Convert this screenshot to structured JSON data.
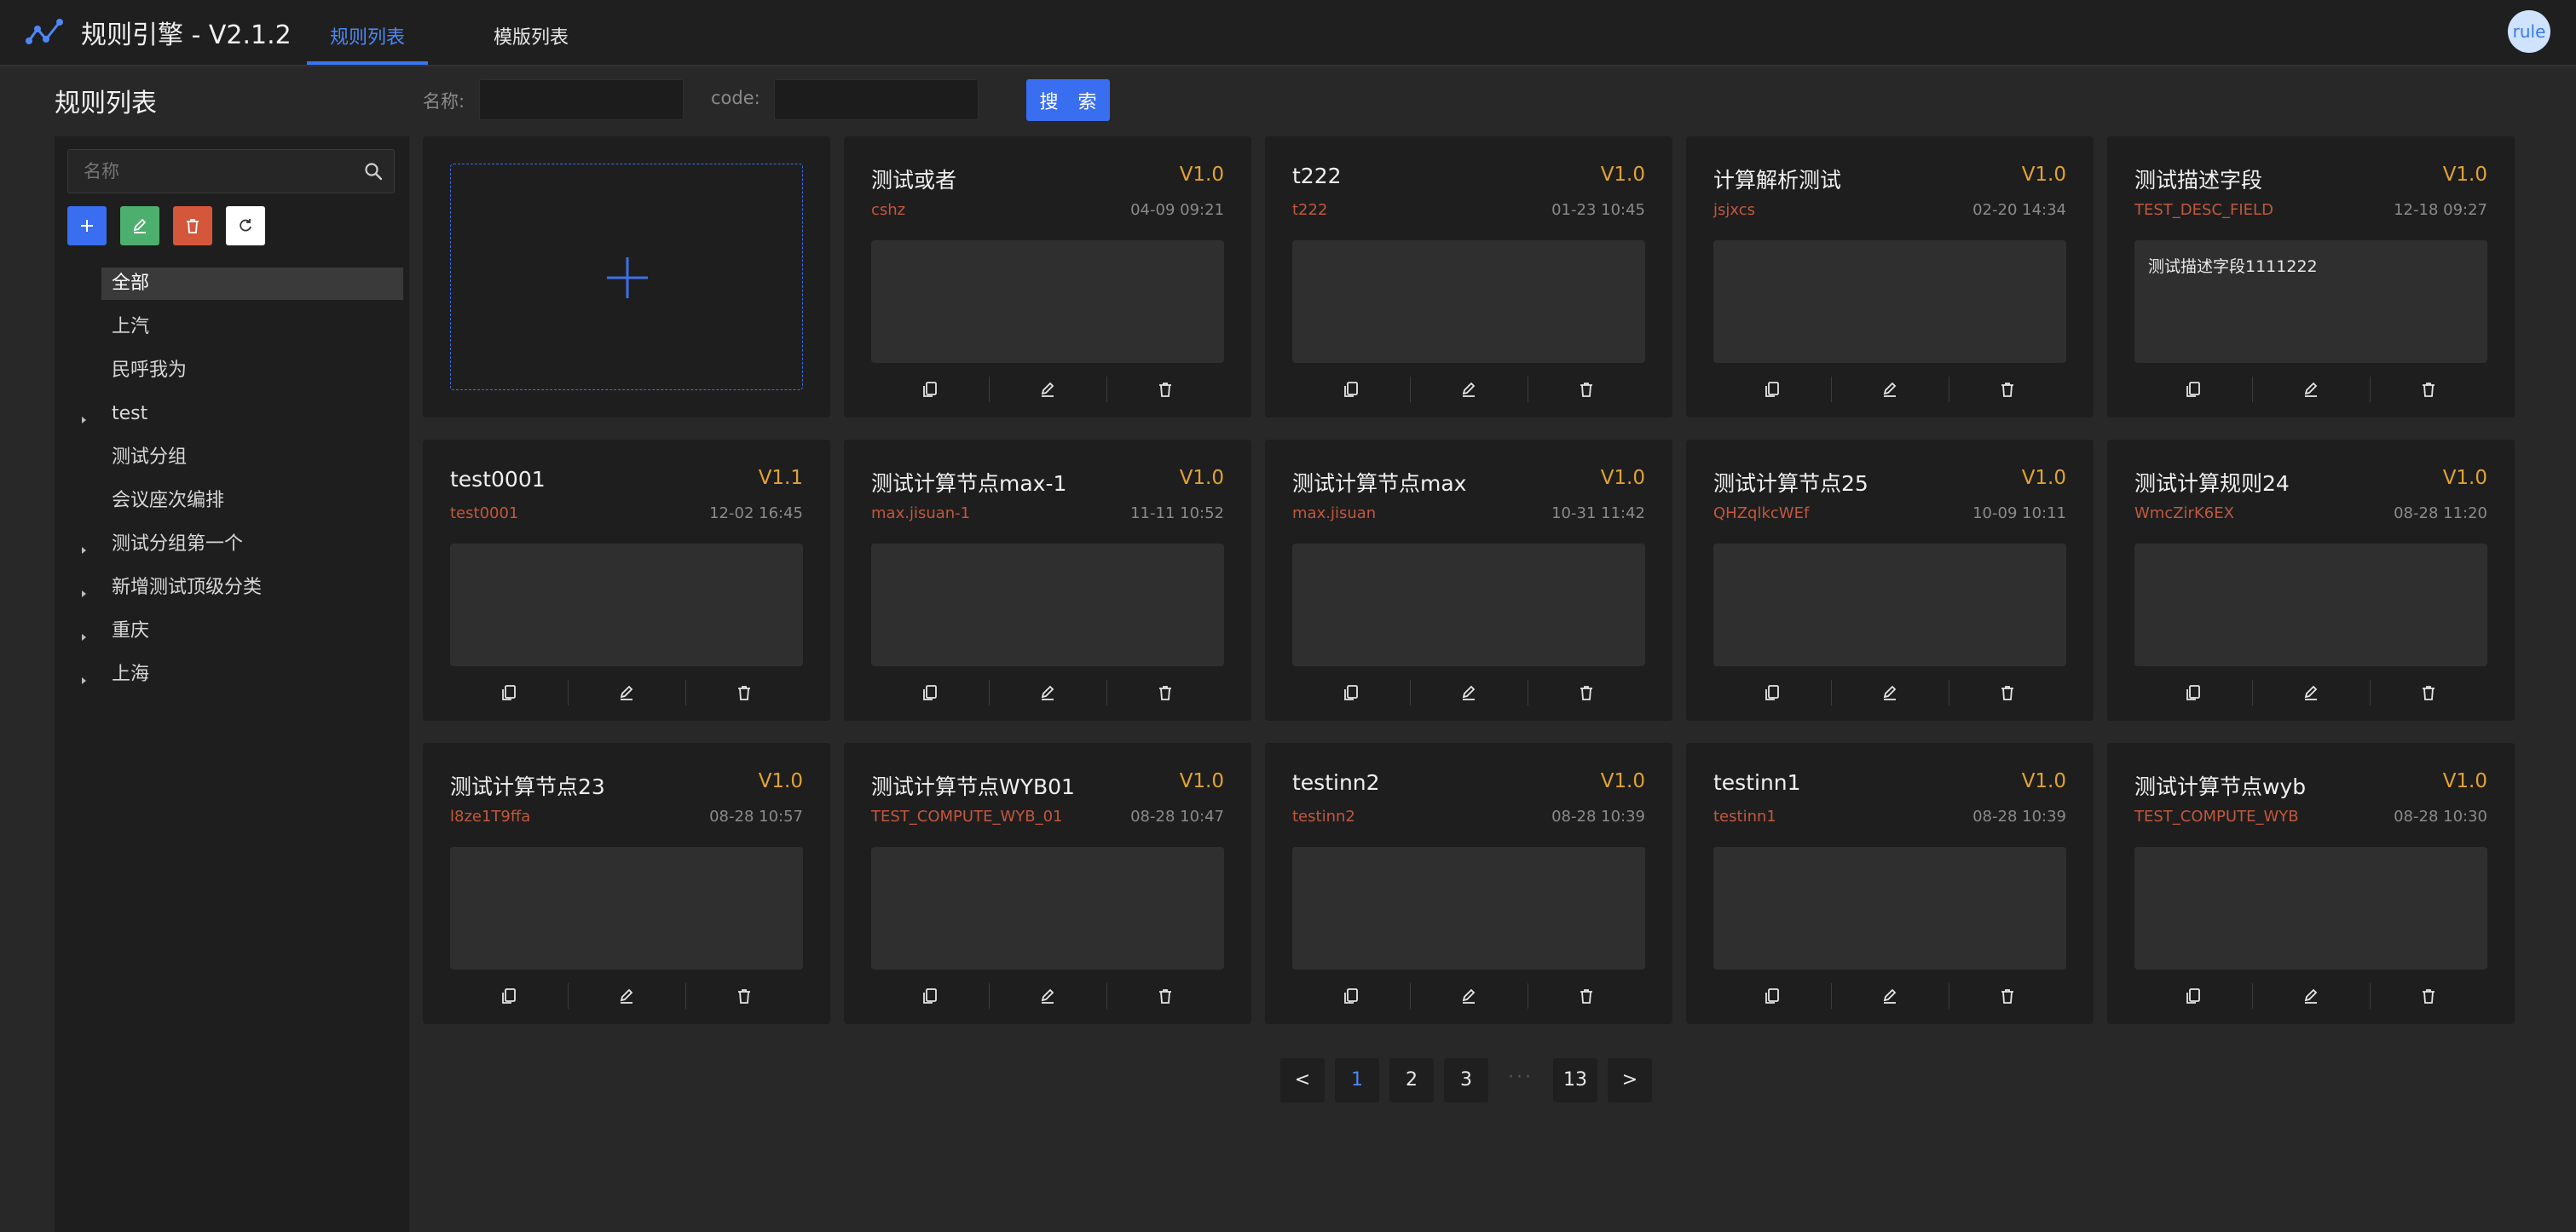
{
  "header": {
    "app_title": "规则引擎 - V2.1.2",
    "tabs": [
      {
        "label": "规则列表",
        "active": true
      },
      {
        "label": "模版列表",
        "active": false
      }
    ],
    "avatar_text": "rule",
    "accent_color": "#3a6ef0"
  },
  "page_title": "规则列表",
  "search": {
    "name_label": "名称:",
    "name_value": "",
    "code_label": "code:",
    "code_value": "",
    "button_label": "搜 索"
  },
  "sidebar": {
    "search_placeholder": "名称",
    "tools": [
      {
        "name": "add",
        "color": "#3a6ef0"
      },
      {
        "name": "edit",
        "color": "#4caf6e"
      },
      {
        "name": "delete",
        "color": "#d4573c"
      },
      {
        "name": "refresh",
        "color": "#ffffff"
      }
    ],
    "tree": [
      {
        "label": "全部",
        "selected": true,
        "has_children": false
      },
      {
        "label": "上汽",
        "selected": false,
        "has_children": false
      },
      {
        "label": "民呼我为",
        "selected": false,
        "has_children": false
      },
      {
        "label": "test",
        "selected": false,
        "has_children": true
      },
      {
        "label": "测试分组",
        "selected": false,
        "has_children": false
      },
      {
        "label": "会议座次编排",
        "selected": false,
        "has_children": false
      },
      {
        "label": "测试分组第一个",
        "selected": false,
        "has_children": true
      },
      {
        "label": "新增测试顶级分类",
        "selected": false,
        "has_children": true
      },
      {
        "label": "重庆",
        "selected": false,
        "has_children": true
      },
      {
        "label": "上海",
        "selected": false,
        "has_children": true
      }
    ]
  },
  "cards": [
    {
      "title": "测试或者",
      "version": "V1.0",
      "code": "cshz",
      "time": "04-09 09:21",
      "desc": ""
    },
    {
      "title": "t222",
      "version": "V1.0",
      "code": "t222",
      "time": "01-23 10:45",
      "desc": ""
    },
    {
      "title": "计算解析测试",
      "version": "V1.0",
      "code": "jsjxcs",
      "time": "02-20 14:34",
      "desc": ""
    },
    {
      "title": "测试描述字段",
      "version": "V1.0",
      "code": "TEST_DESC_FIELD",
      "time": "12-18 09:27",
      "desc": "测试描述字段1111222"
    },
    {
      "title": "test0001",
      "version": "V1.1",
      "code": "test0001",
      "time": "12-02 16:45",
      "desc": ""
    },
    {
      "title": "测试计算节点max-1",
      "version": "V1.0",
      "code": "max.jisuan-1",
      "time": "11-11 10:52",
      "desc": ""
    },
    {
      "title": "测试计算节点max",
      "version": "V1.0",
      "code": "max.jisuan",
      "time": "10-31 11:42",
      "desc": ""
    },
    {
      "title": "测试计算节点25",
      "version": "V1.0",
      "code": "QHZqlkcWEf",
      "time": "10-09 10:11",
      "desc": ""
    },
    {
      "title": "测试计算规则24",
      "version": "V1.0",
      "code": "WmcZirK6EX",
      "time": "08-28 11:20",
      "desc": ""
    },
    {
      "title": "测试计算节点23",
      "version": "V1.0",
      "code": "l8ze1T9ffa",
      "time": "08-28 10:57",
      "desc": ""
    },
    {
      "title": "测试计算节点WYB01",
      "version": "V1.0",
      "code": "TEST_COMPUTE_WYB_01",
      "time": "08-28 10:47",
      "desc": ""
    },
    {
      "title": "testinn2",
      "version": "V1.0",
      "code": "testinn2",
      "time": "08-28 10:39",
      "desc": ""
    },
    {
      "title": "testinn1",
      "version": "V1.0",
      "code": "testinn1",
      "time": "08-28 10:39",
      "desc": ""
    },
    {
      "title": "测试计算节点wyb",
      "version": "V1.0",
      "code": "TEST_COMPUTE_WYB",
      "time": "08-28 10:30",
      "desc": ""
    }
  ],
  "card_actions": [
    "copy-icon",
    "edit-icon",
    "delete-icon"
  ],
  "pagination": {
    "prev": "<",
    "pages": [
      "1",
      "2",
      "3"
    ],
    "ellipsis": "···",
    "last": "13",
    "next": ">",
    "current": "1"
  }
}
